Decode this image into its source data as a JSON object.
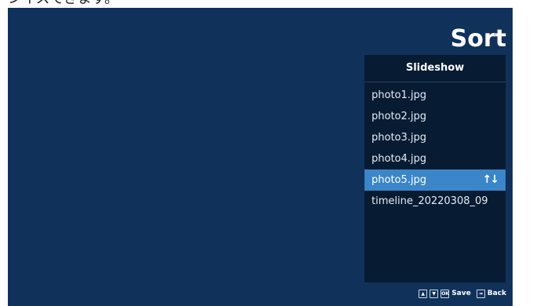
{
  "caption": "ンイスてきます。",
  "title": "Sort",
  "panel": {
    "header": "Slideshow",
    "items": [
      {
        "label": "photo1.jpg",
        "selected": false
      },
      {
        "label": "photo2.jpg",
        "selected": false
      },
      {
        "label": "photo3.jpg",
        "selected": false
      },
      {
        "label": "photo4.jpg",
        "selected": false
      },
      {
        "label": "photo5.jpg",
        "selected": true
      },
      {
        "label": "timeline_20220308_09",
        "selected": false
      }
    ],
    "sort_icon": "↑↓"
  },
  "hints": {
    "up_key": "▲",
    "down_key": "▼",
    "ok_key": "OK",
    "save_label": "Save",
    "back_key": "⇥",
    "back_label": "Back"
  },
  "colors": {
    "background": "#10315a",
    "panel": "#071b33",
    "selection": "#3a86c8"
  }
}
